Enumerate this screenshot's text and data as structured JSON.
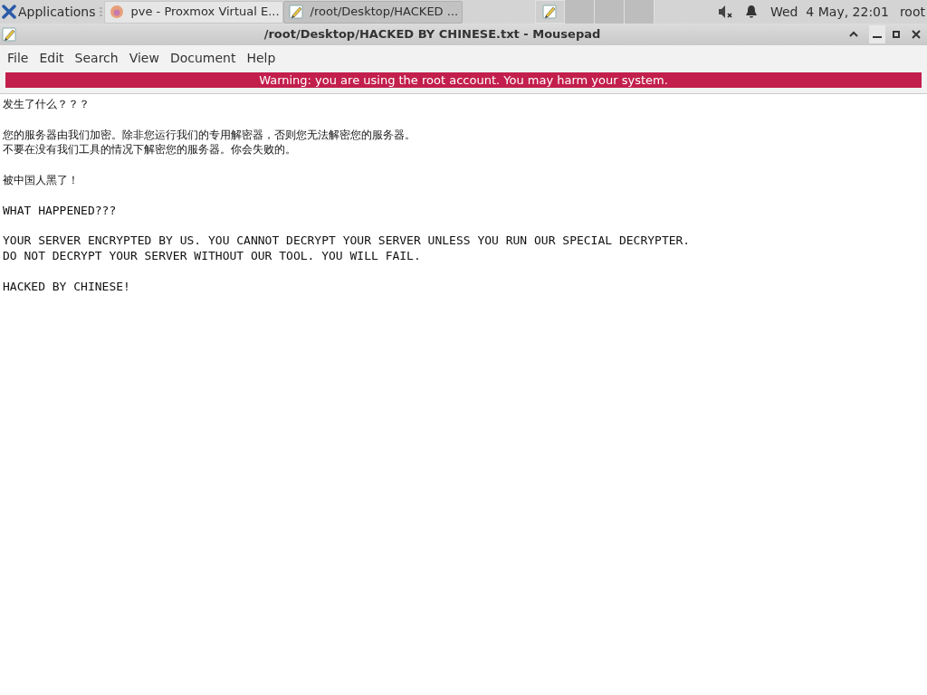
{
  "panel": {
    "applications": "Applications",
    "tasks": [
      {
        "label": "pve - Proxmox Virtual E...",
        "kind": "browser",
        "selected": false
      },
      {
        "label": "/root/Desktop/HACKED ...",
        "kind": "editor",
        "selected": true
      }
    ],
    "workspaces": [
      {
        "selected": true
      },
      {
        "selected": false
      },
      {
        "selected": false
      },
      {
        "selected": false
      }
    ],
    "clock": "Wed  4 May, 22:01",
    "user": "root"
  },
  "window": {
    "title": "/root/Desktop/HACKED BY CHINESE.txt - Mousepad"
  },
  "menu": [
    "File",
    "Edit",
    "Search",
    "View",
    "Document",
    "Help"
  ],
  "warning": "Warning: you are using the root account. You may harm your system.",
  "document": [
    {
      "kind": "cjk",
      "lines": [
        "发生了什么？？？"
      ]
    },
    {
      "kind": "cjk",
      "lines": [
        "您的服务器由我们加密。除非您运行我们的专用解密器，否则您无法解密您的服务器。",
        "不要在没有我们工具的情况下解密您的服务器。你会失败的。"
      ]
    },
    {
      "kind": "cjk",
      "lines": [
        "被中国人黑了！"
      ]
    },
    {
      "kind": "latin",
      "lines": [
        "WHAT HAPPENED???"
      ]
    },
    {
      "kind": "latin",
      "lines": [
        "YOUR SERVER ENCRYPTED BY US. YOU CANNOT DECRYPT YOUR SERVER UNLESS YOU RUN OUR SPECIAL DECRYPTER.",
        "DO NOT DECRYPT YOUR SERVER WITHOUT OUR TOOL. YOU WILL FAIL."
      ]
    },
    {
      "kind": "latin",
      "lines": [
        "HACKED BY CHINESE!"
      ]
    }
  ]
}
